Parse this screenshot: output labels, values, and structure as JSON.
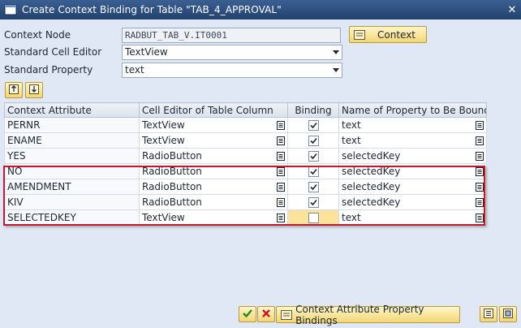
{
  "window": {
    "title": "Create Context Binding for Table \"TAB_4_APPROVAL\"",
    "close_glyph": "✕"
  },
  "fields": {
    "context_node": {
      "label": "Context Node",
      "value": "RADBUT_TAB_V.IT0001"
    },
    "standard_cell_editor": {
      "label": "Standard Cell Editor",
      "value": "TextView"
    },
    "standard_property": {
      "label": "Standard Property",
      "value": "text"
    }
  },
  "context_button": {
    "label": "Context"
  },
  "toolbar": {
    "icons": [
      "insert-row-icon",
      "delete-row-icon"
    ]
  },
  "table": {
    "columns": [
      "Context Attribute",
      "Cell Editor of Table Column",
      "Binding",
      "Name of Property to Be Bound"
    ],
    "rows": [
      {
        "attribute": "PERNR",
        "editor": "TextView",
        "binding": true,
        "property": "text"
      },
      {
        "attribute": "ENAME",
        "editor": "TextView",
        "binding": true,
        "property": "text"
      },
      {
        "attribute": "YES",
        "editor": "RadioButton",
        "binding": true,
        "property": "selectedKey"
      },
      {
        "attribute": "NO",
        "editor": "RadioButton",
        "binding": true,
        "property": "selectedKey"
      },
      {
        "attribute": "AMENDMENT",
        "editor": "RadioButton",
        "binding": true,
        "property": "selectedKey"
      },
      {
        "attribute": "KIV",
        "editor": "RadioButton",
        "binding": true,
        "property": "selectedKey"
      },
      {
        "attribute": "SELECTEDKEY",
        "editor": "TextView",
        "binding": false,
        "property": "text"
      }
    ]
  },
  "footer": {
    "bindings_button": "Context Attribute Property Bindings"
  },
  "colors": {
    "highlight_box": "#c8152f",
    "title_bar": "#23426e",
    "button_face": "#f2d675",
    "selected_cell": "#fde39a"
  }
}
